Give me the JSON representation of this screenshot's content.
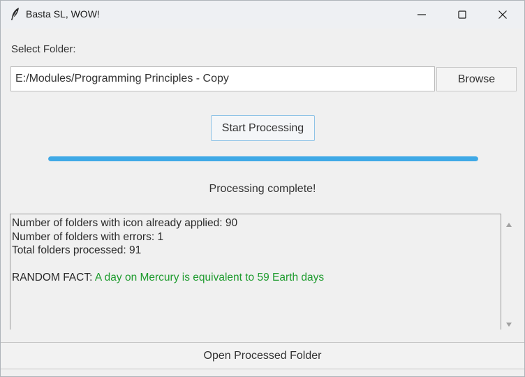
{
  "window": {
    "title": "Basta SL, WOW!"
  },
  "folder": {
    "label": "Select Folder:",
    "path": "E:/Modules/Programming Principles - Copy",
    "browse_label": "Browse"
  },
  "actions": {
    "start_label": "Start Processing",
    "open_label": "Open Processed Folder"
  },
  "progress": {
    "fraction": 1.0,
    "status": "Processing complete!",
    "color": "#3fa9e6"
  },
  "log": {
    "lines": [
      "Number of folders with icon already applied: 90",
      "Number of folders with errors: 1",
      "Total folders processed: 91"
    ],
    "fact_prefix": "RANDOM FACT: ",
    "fact_text": "A day on Mercury is equivalent to 59 Earth days",
    "fact_color": "#1e9b2e"
  }
}
